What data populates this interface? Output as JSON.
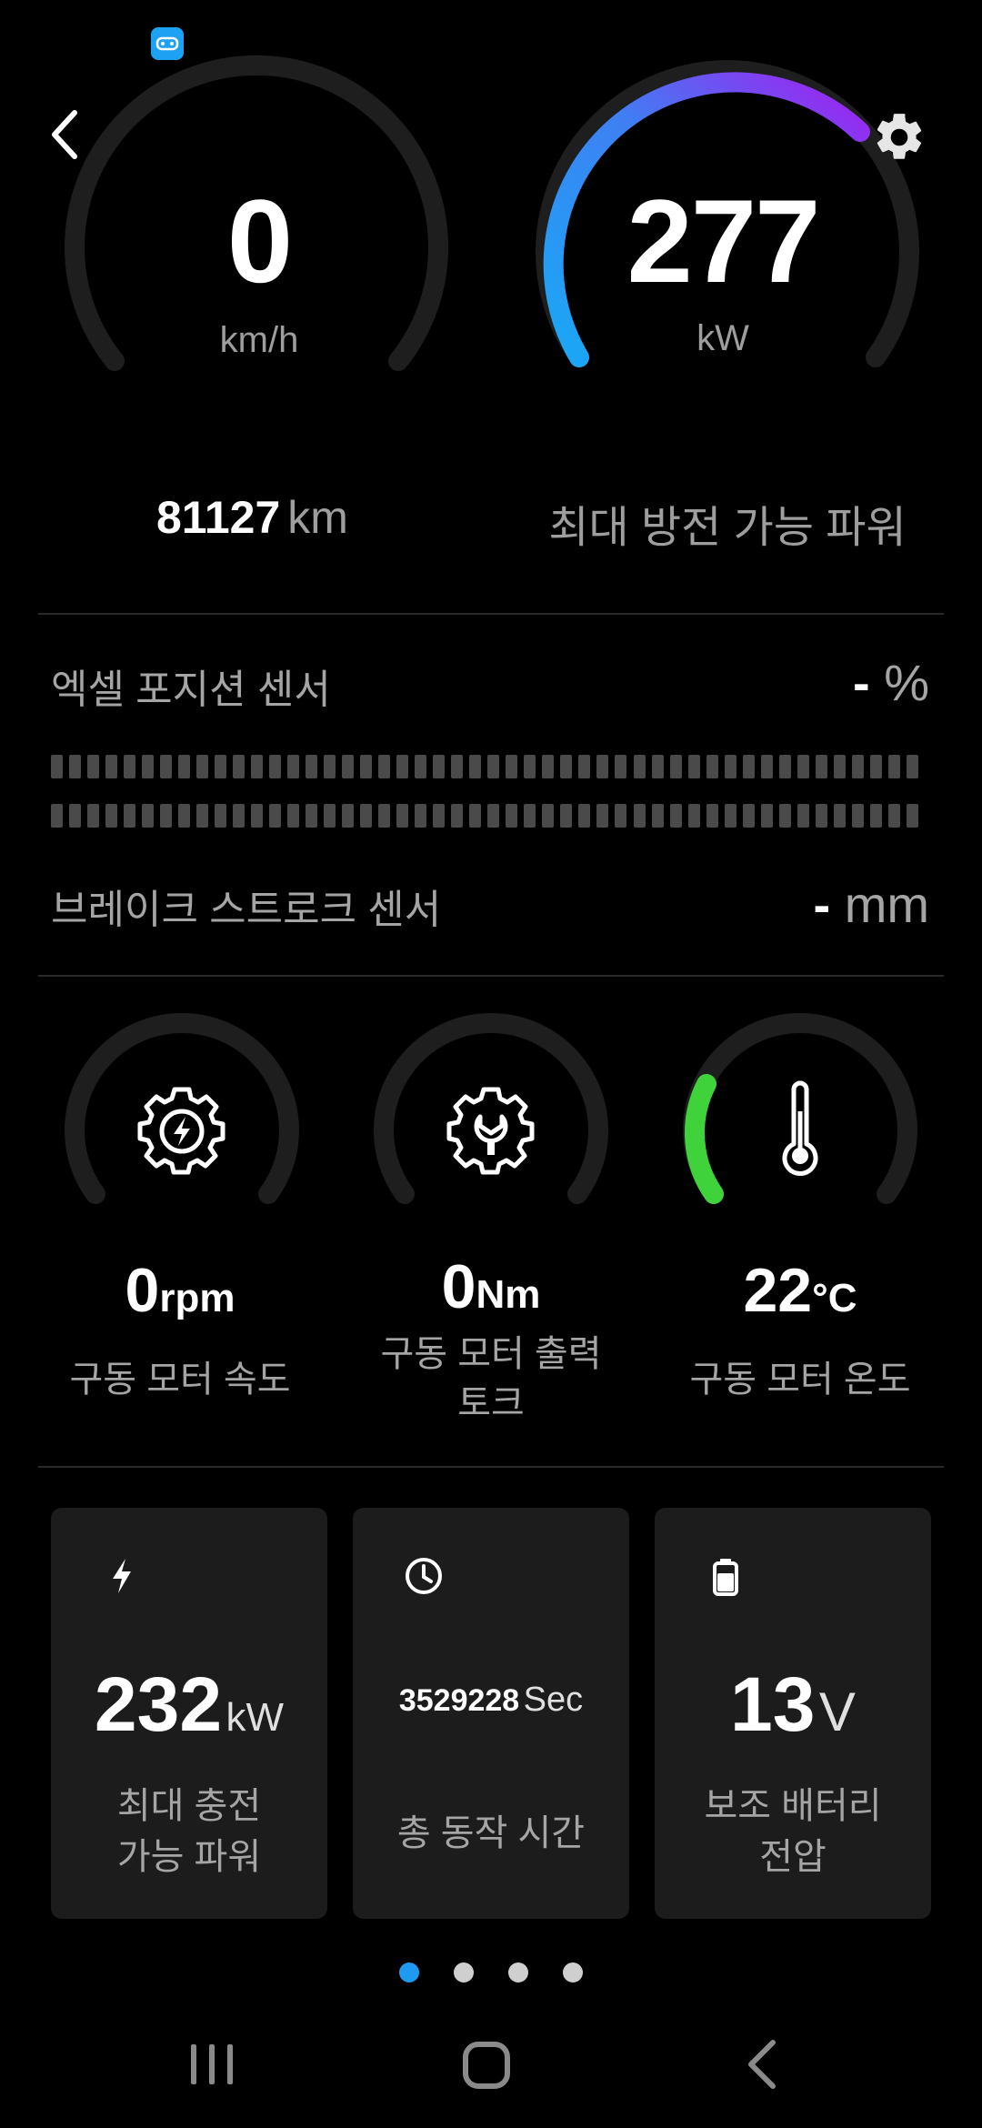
{
  "status_bar": {
    "app_icon": "car-controller-icon"
  },
  "header": {
    "back_icon": "chevron-left-icon",
    "settings_icon": "gear-icon"
  },
  "speed_gauge": {
    "value": "0",
    "unit": "km/h",
    "level": 0
  },
  "power_gauge": {
    "value": "277",
    "unit": "kW",
    "level": 0.74,
    "gradient": [
      "#1aa8f5",
      "#a21ef0"
    ]
  },
  "odometer": {
    "value": "81127",
    "unit": "km"
  },
  "max_discharge_label": "최대 방전 가능 파워",
  "accel_sensor": {
    "label": "엑셀 포지션 센서",
    "value": "-",
    "unit": "%"
  },
  "brake_sensor": {
    "label": "브레이크 스트로크 센서",
    "value": "-",
    "unit": "mm"
  },
  "motor_speed": {
    "value": "0",
    "unit": "rpm",
    "label": "구동 모터 속도",
    "icon": "gear-bolt-icon"
  },
  "motor_torque": {
    "value": "0",
    "unit": "Nm",
    "label_line1": "구동 모터 출력",
    "label_line2": "토크",
    "icon": "gear-wrench-icon"
  },
  "motor_temp": {
    "value": "22",
    "unit": "°C",
    "label": "구동 모터 온도",
    "icon": "thermometer-icon",
    "level": 0.18,
    "color": "#3fd23a"
  },
  "cards": {
    "max_charge": {
      "value": "232",
      "unit": "kW",
      "label_line1": "최대 충전",
      "label_line2": "가능 파워",
      "icon": "lightning-icon"
    },
    "operating_time": {
      "value": "3529228",
      "unit": "Sec",
      "label": "총 동작 시간",
      "icon": "clock-icon"
    },
    "aux_battery": {
      "value": "13",
      "unit": "V",
      "label_line1": "보조 배터리",
      "label_line2": "전압",
      "icon": "battery-icon"
    }
  },
  "pager": {
    "count": 4,
    "active": 0,
    "active_color": "#1e9bf0"
  },
  "navbar": {
    "recents_icon": "recents-icon",
    "home_icon": "home-icon",
    "back_icon": "back-icon"
  }
}
